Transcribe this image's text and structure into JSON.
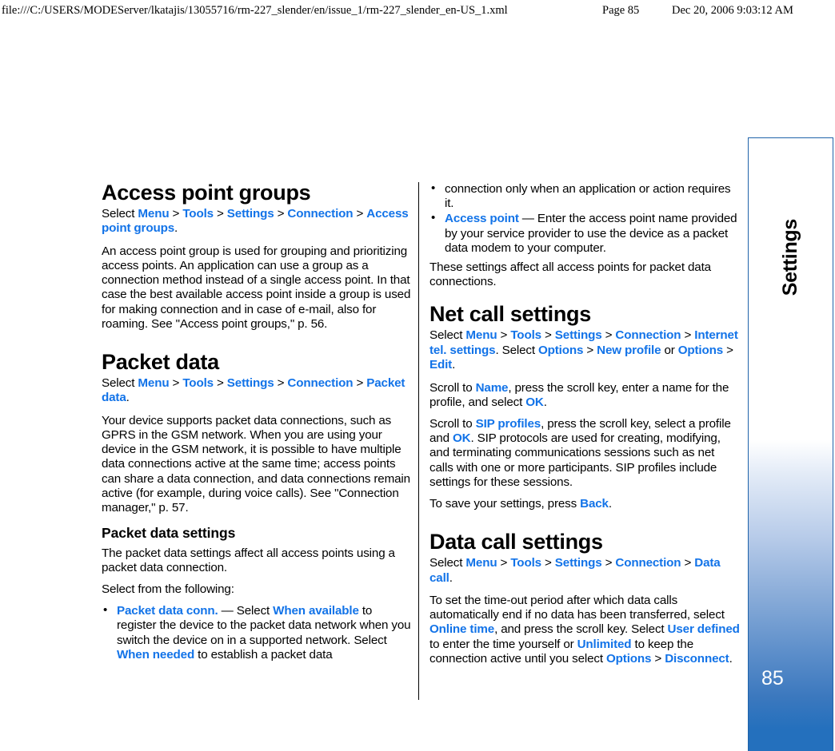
{
  "print_header": {
    "url": "file:///C:/USERS/MODEServer/lkatajis/13055716/rm-227_slender/en/issue_1/rm-227_slender_en-US_1.xml",
    "page": "Page 85",
    "date": "Dec 20, 2006 9:03:12 AM"
  },
  "side_strip": {
    "tab_label": "Settings",
    "page_number": "85",
    "accent_color": "#2470bd",
    "border_color": "#1f63aa"
  },
  "theme": {
    "ui_link_color": "#1273e8",
    "text_color": "#000000",
    "background": "#ffffff"
  },
  "left_column": {
    "section1": {
      "heading": "Access point groups",
      "path_prefix": "Select ",
      "path_items": [
        "Menu",
        "Tools",
        "Settings",
        "Connection",
        "Access point groups"
      ],
      "path_suffix": ".",
      "body": "An access point group is used for grouping and prioritizing access points. An application can use a group as a connection method instead of a single access point. In that case the best available access point inside a group is used for making connection and in case of e-mail, also for roaming. See \"Access point groups,\" p. 56."
    },
    "section2": {
      "heading": "Packet data",
      "path_prefix": "Select ",
      "path_items": [
        "Menu",
        "Tools",
        "Settings",
        "Connection",
        "Packet data"
      ],
      "path_suffix": ".",
      "body": "Your device supports packet data connections, such as GPRS in the GSM network. When you are using your device in the GSM network, it is possible to have multiple data connections active at the same time; access points can share a data connection, and data connections remain active (for example, during voice calls). See \"Connection manager,\" p. 57."
    },
    "section3": {
      "subheading": "Packet data settings",
      "body1": "The packet data settings affect all access points using a packet data connection.",
      "body2": "Select from the following:",
      "bullet1": {
        "term": "Packet data conn.",
        "dash": " — Select ",
        "value1": "When available",
        "text1": " to register the device to the packet data network when you switch the device on in a supported network. Select ",
        "value2": "When needed",
        "text2": " to establish a packet data"
      }
    }
  },
  "right_column": {
    "bullet1_continued": "connection only when an application or action requires it.",
    "bullet2": {
      "term": "Access point",
      "text": " — Enter the access point name provided by your service provider to use the device as a packet data modem to your computer."
    },
    "after_bullets": "These settings affect all access points for packet data connections.",
    "section1": {
      "heading": "Net call settings",
      "path_prefix": "Select ",
      "path_items": [
        "Menu",
        "Tools",
        "Settings",
        "Connection",
        "Internet tel. settings"
      ],
      "path_mid": ". Select ",
      "path_items2": [
        "Options",
        "New profile"
      ],
      "path_or": " or ",
      "path_items3": [
        "Options",
        "Edit"
      ],
      "path_suffix": ".",
      "para1_a": "Scroll to ",
      "para1_ui1": "Name",
      "para1_b": ", press the scroll key, enter a name for the profile, and select ",
      "para1_ui2": "OK",
      "para1_c": ".",
      "para2_a": "Scroll to ",
      "para2_ui1": "SIP profiles",
      "para2_b": ", press the scroll key, select a profile and ",
      "para2_ui2": "OK",
      "para2_c": ". SIP protocols are used for creating, modifying, and terminating communications sessions such as net calls with one or more participants. SIP profiles include settings for these sessions.",
      "para3_a": "To save your settings, press ",
      "para3_ui1": "Back",
      "para3_b": "."
    },
    "section2": {
      "heading": "Data call settings",
      "path_prefix": "Select ",
      "path_items": [
        "Menu",
        "Tools",
        "Settings",
        "Connection",
        "Data call"
      ],
      "path_suffix": ".",
      "para_a": "To set the time-out period after which data calls automatically end if no data has been transferred, select ",
      "para_ui1": "Online time",
      "para_b": ", and press the scroll key. Select ",
      "para_ui2": "User defined",
      "para_c": " to enter the time yourself or ",
      "para_ui3": "Unlimited",
      "para_d": " to keep the connection active until you select ",
      "para_ui4": "Options",
      "para_e": " > ",
      "para_ui5": "Disconnect",
      "para_f": "."
    }
  }
}
